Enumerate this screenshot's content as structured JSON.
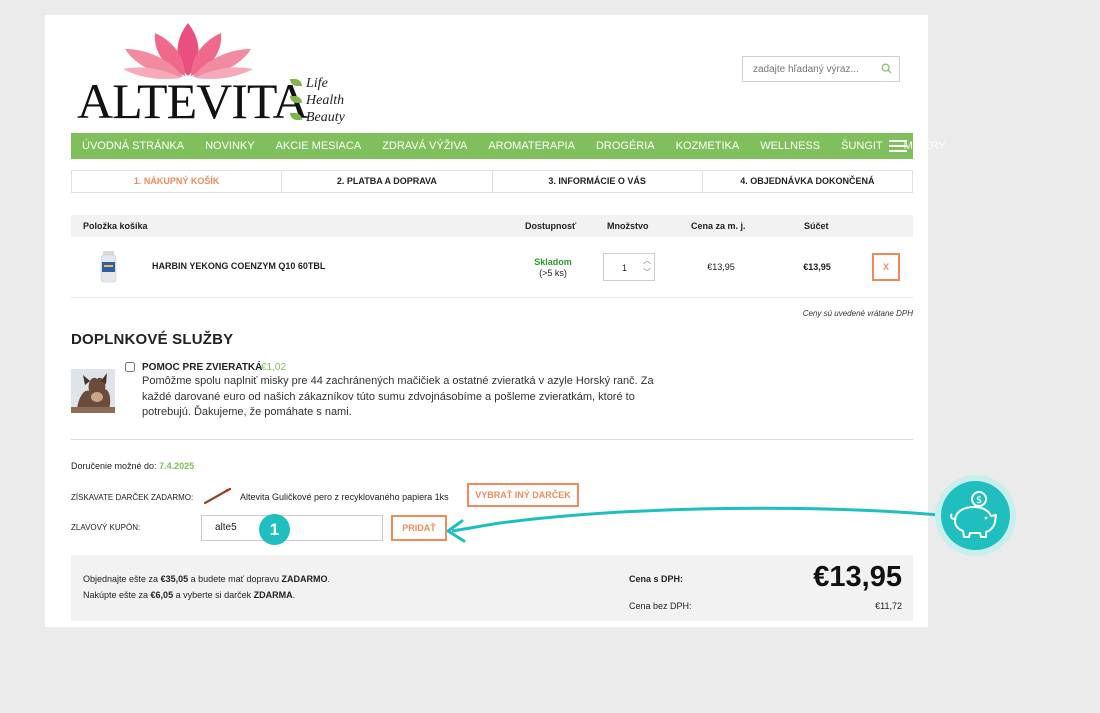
{
  "brand": {
    "name": "ALTEVITA",
    "slogan": [
      "Life",
      "Health",
      "Beauty"
    ]
  },
  "search": {
    "placeholder": "zadajte hľadaný výraz..."
  },
  "nav": {
    "items": [
      "ÚVODNÁ STRÁNKA",
      "NOVINKY",
      "AKCIE MESIACA",
      "ZDRAVÁ VÝŽIVA",
      "AROMATERAPIA",
      "DROGÉRIA",
      "KOZMETIKA",
      "WELLNESS",
      "ŠUNGIT",
      "MIXÉRY"
    ]
  },
  "steps": [
    "1. NÁKUPNÝ KOŠÍK",
    "2. PLATBA A DOPRAVA",
    "3. INFORMÁCIE O VÁS",
    "4. OBJEDNÁVKA DOKONČENÁ"
  ],
  "cart": {
    "headers": {
      "item": "Položka košíka",
      "availability": "Dostupnosť",
      "quantity": "Množstvo",
      "unit_price": "Cena za m. j.",
      "total": "Súčet"
    },
    "item": {
      "name": "HARBIN YEKONG COENZYM Q10 60TBL",
      "stock": "Skladom",
      "stock_count": "(>5 ks)",
      "quantity": "1",
      "unit_price": "€13,95",
      "total": "€13,95",
      "remove": "X"
    },
    "vat_note": "Ceny sú uvedené vrátane DPH"
  },
  "services": {
    "title": "DOPLNKOVÉ SLUŽBY",
    "item": {
      "name": "POMOC PRE ZVIERATKÁ",
      "price": "€1,02",
      "description": "Pomôžme spolu naplniť misky pre 44 zachránených mačičiek a ostatné zvieratká v azyle Horský ranč. Za každé darované euro od našich zákazníkov túto sumu zdvojnásobíme a pošleme zvieratkám, ktoré to potrebujú. Ďakujeme, že pomáhate s nami."
    }
  },
  "delivery": {
    "label": "Doručenie možné do:",
    "date": "7.4.2025"
  },
  "gift": {
    "label": "ZÍSKAVATE DARČEK ZADARMO:",
    "name": "Altevita Guličkové pero z recyklovaného papiera 1ks",
    "button": "VYBRAŤ INÝ DARČEK"
  },
  "coupon": {
    "label": "ZLAVOVÝ KUPÓN:",
    "value": "alte5",
    "button": "PRIDAŤ"
  },
  "summary": {
    "line1_pre": "Objednajte ešte za ",
    "line1_amount": "€35,05",
    "line1_mid": " a budete mať dopravu ",
    "line1_bold": "ZADARMO",
    "line1_end": ".",
    "line2_pre": "Nakúpte ešte za ",
    "line2_amount": "€6,05",
    "line2_mid": " a vyberte si darček ",
    "line2_bold": "ZDARMA",
    "line2_end": ".",
    "with_vat_label": "Cena s DPH:",
    "with_vat_value": "€13,95",
    "without_vat_label": "Cena bez DPH:",
    "without_vat_value": "€11,72"
  },
  "annotation": {
    "marker": "1"
  },
  "colors": {
    "accent": "#f08a5d",
    "nav": "#7fbf5c",
    "teal": "#1fbfbf",
    "stock_green": "#2a9a2a"
  }
}
